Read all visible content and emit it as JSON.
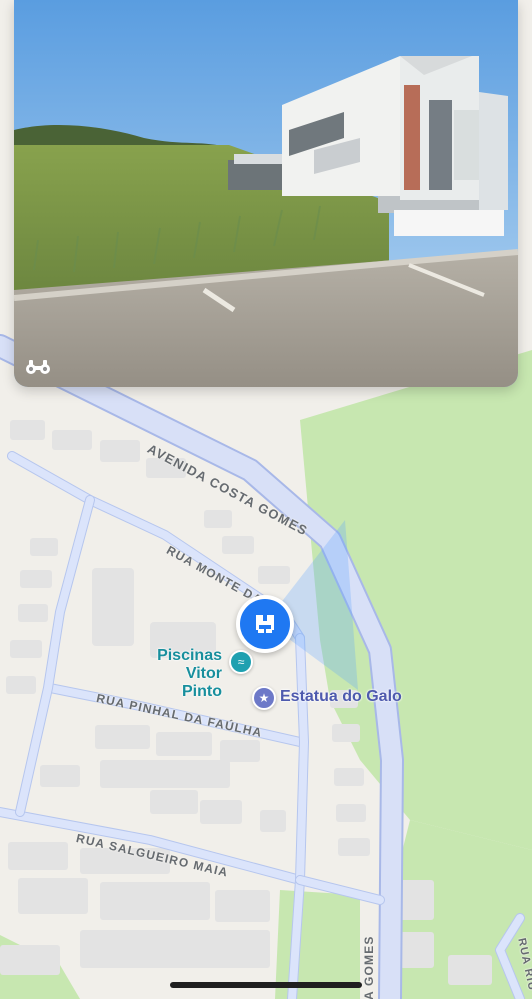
{
  "map": {
    "streets": {
      "avenida": "AVENIDA COSTA GOMES",
      "monte": "RUA MONTE DA",
      "pinhal": "RUA PINHAL DA FAÚLHA",
      "salgueiro": "RUA SALGUEIRO MAIA",
      "bottom_avenida": "A GOMES",
      "bottom_right": "RUA RIU"
    },
    "poi": {
      "name": "Piscinas\nVitor Pinto",
      "icon": "swimming-icon"
    },
    "landmark": {
      "name": "Estatua do Galo",
      "icon": "star-icon"
    }
  },
  "preview": {
    "icon": "binoculars-icon"
  },
  "colors": {
    "road": "#d8e0f7",
    "road_outline": "#a8b8e8",
    "park": "#c7e7b0",
    "building": "#e3e3e3",
    "background": "#f1efea",
    "user_blue": "#1f78f2"
  }
}
